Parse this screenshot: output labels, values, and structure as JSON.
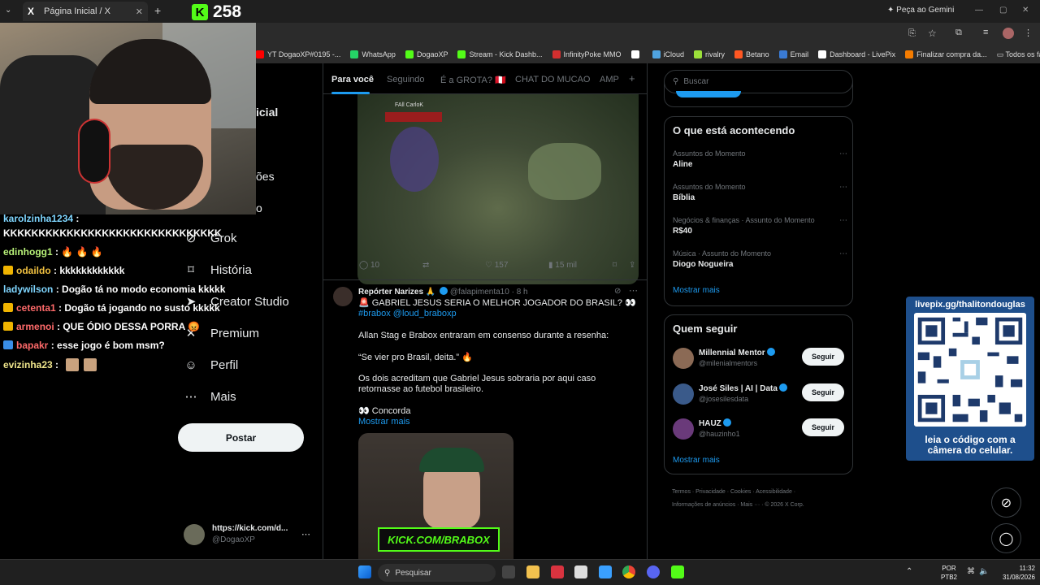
{
  "browser": {
    "tab_title": "Página Inicial / X",
    "gemini_label": "Peça ao Gemini",
    "bookmarks": [
      {
        "label": "YT DogaoXP#0195 -...",
        "color": "#ff0000"
      },
      {
        "label": "WhatsApp",
        "color": "#25d366"
      },
      {
        "label": "DogaoXP",
        "color": "#53fc18"
      },
      {
        "label": "Stream - Kick Dashb...",
        "color": "#53fc18"
      },
      {
        "label": "InfinityPoke MMO",
        "color": "#d32f2f"
      },
      {
        "label": "",
        "color": "#ffffff"
      },
      {
        "label": "iCloud",
        "color": "#4fa3e0"
      },
      {
        "label": "rivalry",
        "color": "#9be03a"
      },
      {
        "label": "Betano",
        "color": "#ff5722"
      },
      {
        "label": "Email",
        "color": "#3a7bd5"
      },
      {
        "label": "Dashboard - LivePix",
        "color": "#ffffff"
      },
      {
        "label": "Finalizar compra da...",
        "color": "#f57c00"
      }
    ],
    "all_favorites": "Todos os favoritos"
  },
  "kick": {
    "viewers": "258"
  },
  "chat": [
    {
      "user": "karolzinha1234",
      "user_color": "#7fd6ff",
      "text": " :",
      "badge": ""
    },
    {
      "user": "",
      "user_color": "#ffffff",
      "text": "KKKKKKKKKKKKKKKKKKKKKKKKKKKKKKK",
      "badge": ""
    },
    {
      "user": "edinhogg1",
      "user_color": "#b9f279",
      "text": " : 🔥 🔥 🔥",
      "badge": ""
    },
    {
      "user": "odaildo",
      "user_color": "#f0c040",
      "text": " : kkkkkkkkkkkk",
      "badge": "#f0b400"
    },
    {
      "user": "ladywilson",
      "user_color": "#7fd6ff",
      "text": " : Dogão tá no modo economia kkkkk",
      "badge": ""
    },
    {
      "user": "cetenta1",
      "user_color": "#ff6a6a",
      "text": " : Dogão tá jogando no susto kkkkk",
      "badge": "#f0b400"
    },
    {
      "user": "armenoi",
      "user_color": "#ff6a6a",
      "text": " : QUE ÓDIO DESSA PORRA 😡",
      "badge": "#f0b400"
    },
    {
      "user": "bapakr",
      "user_color": "#ff6a6a",
      "text": " : esse jogo é bom msm?",
      "badge": "#3a8ee6"
    },
    {
      "user": "evizinha23",
      "user_color": "#f0e68c",
      "text": " : ",
      "badge": ""
    }
  ],
  "nav": {
    "partial_title": "icial",
    "partial_notif": "ões",
    "partial_msg": "o",
    "items": [
      {
        "label": "Grok",
        "icon": "grok-icon",
        "glyph": "⊘"
      },
      {
        "label": "História",
        "icon": "bookmark-icon",
        "glyph": "⌑"
      },
      {
        "label": "Creator Studio",
        "icon": "creator-icon",
        "glyph": "➤"
      },
      {
        "label": "Premium",
        "icon": "premium-icon",
        "glyph": "✕"
      },
      {
        "label": "Perfil",
        "icon": "profile-icon",
        "glyph": "☺"
      },
      {
        "label": "Mais",
        "icon": "more-icon",
        "glyph": "⋯"
      }
    ],
    "post_button": "Postar",
    "profile_name": "https://kick.com/d...",
    "profile_handle": "@DogaoXP"
  },
  "feed": {
    "tabs": [
      "Para você",
      "Seguindo",
      "É a GROTA? 🇵🇪",
      "CHAT DO MUCAO",
      "AMP"
    ],
    "tab_add": "+",
    "tweet1_game_text": "FAll CarloK",
    "tweet1_actions": {
      "replies": "10",
      "retweets": "",
      "likes": "157",
      "views": "15 mil"
    },
    "tweet2": {
      "author": "Repórter Narizes 🙏",
      "handle": "@falapimenta10 · 8 h",
      "line1": "🚨 GABRIEL JESUS SERIA O MELHOR JOGADOR DO BRASIL? 👀",
      "tags": "#brabox @loud_braboxp",
      "p1": "Allan Stag e Brabox entraram em consenso durante a resenha:",
      "p2": "“Se vier pro Brasil, deita.” 🔥",
      "p3": "Os dois acreditam que Gabriel Jesus sobraria por aqui caso retornasse ao futebol brasileiro.",
      "p4": "👀 Concorda",
      "more": "Mostrar mais",
      "image_brand": "KICK.COM/BRABOX"
    }
  },
  "right": {
    "search_placeholder": "Buscar",
    "trends_title": "O que está acontecendo",
    "trends": [
      {
        "category": "Assuntos do Momento",
        "name": "Aline"
      },
      {
        "category": "Assuntos do Momento",
        "name": "Bíblia"
      },
      {
        "category": "Negócios & finanças · Assunto do Momento",
        "name": "R$40"
      },
      {
        "category": "Música · Assunto do Momento",
        "name": "Diogo Nogueira"
      }
    ],
    "trends_more": "Mostrar mais",
    "follow_title": "Quem seguir",
    "follow": [
      {
        "name": "Millennial Mentor",
        "handle": "@milenialmentors",
        "button": "Seguir",
        "avatar": "#8b6a55"
      },
      {
        "name": "José Siles | AI | Data",
        "handle": "@josesilesdata",
        "button": "Seguir",
        "avatar": "#3a5a8a"
      },
      {
        "name": "HAUZ",
        "handle": "@hauzinho1",
        "button": "Seguir",
        "avatar": "#6a3a7a"
      }
    ],
    "follow_more": "Mostrar mais",
    "footer_line1": "Termos · Privacidade · Cookies · Acessibilidade ·",
    "footer_line2": "Informações de anúncios · Mais ··· · © 2026 X Corp."
  },
  "qr": {
    "url": "livepix.gg/thalitondouglas",
    "caption1": "leia o código com a",
    "caption2": "câmera do celular."
  },
  "taskbar": {
    "search": "Pesquisar",
    "lang1": "POR",
    "lang2": "PTB2",
    "time": "11:32",
    "date": "31/08/2026"
  }
}
